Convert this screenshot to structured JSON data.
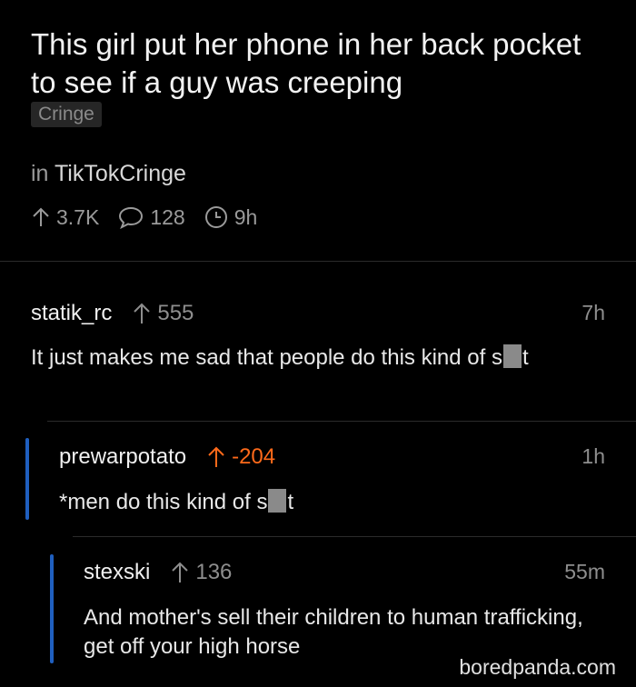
{
  "post": {
    "title": "This girl put her phone in her back pocket to see if a guy was creeping",
    "flair": "Cringe",
    "subreddit_prefix": "in",
    "subreddit": "TikTokCringe",
    "upvotes": "3.7K",
    "comments": "128",
    "age": "9h"
  },
  "comments": [
    {
      "author": "statik_rc",
      "score": "555",
      "age": "7h",
      "text_before": "It just makes me sad that people do this kind of s",
      "text_after": "t"
    },
    {
      "author": "prewarpotato",
      "score": "-204",
      "age": "1h",
      "text_before": "*men do this kind of s",
      "text_after": "t"
    },
    {
      "author": "stexski",
      "score": "136",
      "age": "55m",
      "text": "And mother's sell their children to human trafficking, get off your high horse"
    }
  ],
  "watermark": "boredpanda.com",
  "colors": {
    "background": "#000000",
    "negative_score": "#ff6a1a",
    "thread_bar": "#1f5fbf",
    "flair_bg": "#262626"
  },
  "icons": {
    "upvote": "arrow-up-icon",
    "comments": "speech-bubble-icon",
    "age": "clock-icon"
  }
}
